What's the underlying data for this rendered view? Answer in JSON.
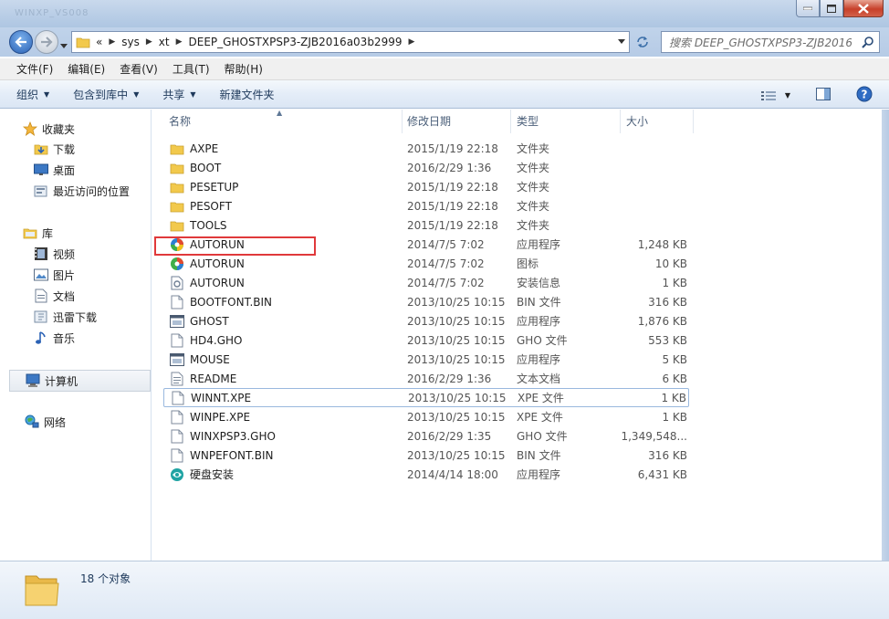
{
  "window": {
    "title_ghost": "WINXP_VS008"
  },
  "address": {
    "overflow": "«",
    "crumbs": [
      "sys",
      "xt",
      "DEEP_GHOSTXPSP3-ZJB2016a03b2999"
    ],
    "search_placeholder": "搜索 DEEP_GHOSTXPSP3-ZJB2016..."
  },
  "menu": [
    "文件(F)",
    "编辑(E)",
    "查看(V)",
    "工具(T)",
    "帮助(H)"
  ],
  "commands": {
    "organize": "组织",
    "include_library": "包含到库中",
    "share": "共享",
    "new_folder": "新建文件夹"
  },
  "nav": {
    "favorites": "收藏夹",
    "downloads": "下载",
    "desktop": "桌面",
    "recent": "最近访问的位置",
    "libraries": "库",
    "videos": "视频",
    "pictures": "图片",
    "documents": "文档",
    "thunder": "迅雷下载",
    "music": "音乐",
    "computer": "计算机",
    "network": "网络"
  },
  "columns": {
    "name": "名称",
    "date": "修改日期",
    "type": "类型",
    "size": "大小"
  },
  "files": [
    {
      "name": "AXPE",
      "date": "2015/1/19 22:18",
      "type": "文件夹",
      "size": "",
      "icon": "folder-icon"
    },
    {
      "name": "BOOT",
      "date": "2016/2/29 1:36",
      "type": "文件夹",
      "size": "",
      "icon": "folder-icon"
    },
    {
      "name": "PESETUP",
      "date": "2015/1/19 22:18",
      "type": "文件夹",
      "size": "",
      "icon": "folder-icon"
    },
    {
      "name": "PESOFT",
      "date": "2015/1/19 22:18",
      "type": "文件夹",
      "size": "",
      "icon": "folder-icon"
    },
    {
      "name": "TOOLS",
      "date": "2015/1/19 22:18",
      "type": "文件夹",
      "size": "",
      "icon": "folder-icon"
    },
    {
      "name": "AUTORUN",
      "date": "2014/7/5 7:02",
      "type": "应用程序",
      "size": "1,248 KB",
      "icon": "autorun-app-icon"
    },
    {
      "name": "AUTORUN",
      "date": "2014/7/5 7:02",
      "type": "图标",
      "size": "10 KB",
      "icon": "autorun-ico-icon"
    },
    {
      "name": "AUTORUN",
      "date": "2014/7/5 7:02",
      "type": "安装信息",
      "size": "1 KB",
      "icon": "setup-info-icon"
    },
    {
      "name": "BOOTFONT.BIN",
      "date": "2013/10/25 10:15",
      "type": "BIN 文件",
      "size": "316 KB",
      "icon": "blank-file-icon"
    },
    {
      "name": "GHOST",
      "date": "2013/10/25 10:15",
      "type": "应用程序",
      "size": "1,876 KB",
      "icon": "exe-window-icon"
    },
    {
      "name": "HD4.GHO",
      "date": "2013/10/25 10:15",
      "type": "GHO 文件",
      "size": "553 KB",
      "icon": "blank-file-icon"
    },
    {
      "name": "MOUSE",
      "date": "2013/10/25 10:15",
      "type": "应用程序",
      "size": "5 KB",
      "icon": "exe-window-icon"
    },
    {
      "name": "README",
      "date": "2016/2/29 1:36",
      "type": "文本文档",
      "size": "6 KB",
      "icon": "text-file-icon"
    },
    {
      "name": "WINNT.XPE",
      "date": "2013/10/25 10:15",
      "type": "XPE 文件",
      "size": "1 KB",
      "icon": "blank-file-icon"
    },
    {
      "name": "WINPE.XPE",
      "date": "2013/10/25 10:15",
      "type": "XPE 文件",
      "size": "1 KB",
      "icon": "blank-file-icon"
    },
    {
      "name": "WINXPSP3.GHO",
      "date": "2016/2/29 1:35",
      "type": "GHO 文件",
      "size": "1,349,548...",
      "icon": "blank-file-icon"
    },
    {
      "name": "WNPEFONT.BIN",
      "date": "2013/10/25 10:15",
      "type": "BIN 文件",
      "size": "316 KB",
      "icon": "blank-file-icon"
    },
    {
      "name": "硬盘安装",
      "date": "2014/4/14 18:00",
      "type": "应用程序",
      "size": "6,431 KB",
      "icon": "installer-icon"
    }
  ],
  "status": {
    "count": "18 个对象"
  },
  "colors": {
    "accent": "#2b62b5",
    "highlight": "#e0393b",
    "folder": "#f2c94c"
  }
}
